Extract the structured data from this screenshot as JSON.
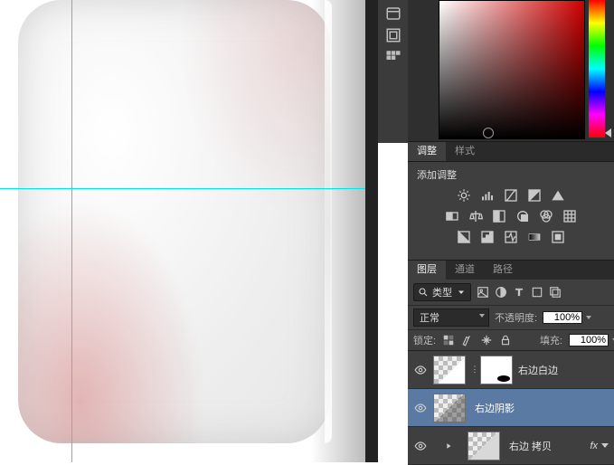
{
  "adjust_tabs": {
    "adjust": "调整",
    "styles": "样式"
  },
  "adjust_title": "添加调整",
  "layer_tabs": {
    "layers": "图层",
    "channels": "通道",
    "paths": "路径"
  },
  "kind_filter_label": "类型",
  "blend_mode": "正常",
  "opacity_label": "不透明度:",
  "opacity_value": "100%",
  "lock_label": "锁定:",
  "fill_label": "填充:",
  "fill_value": "100%",
  "layers": [
    {
      "name": "右边白边"
    },
    {
      "name": "右边阴影"
    },
    {
      "name": "右边 拷贝"
    }
  ],
  "fx_label": "fx"
}
